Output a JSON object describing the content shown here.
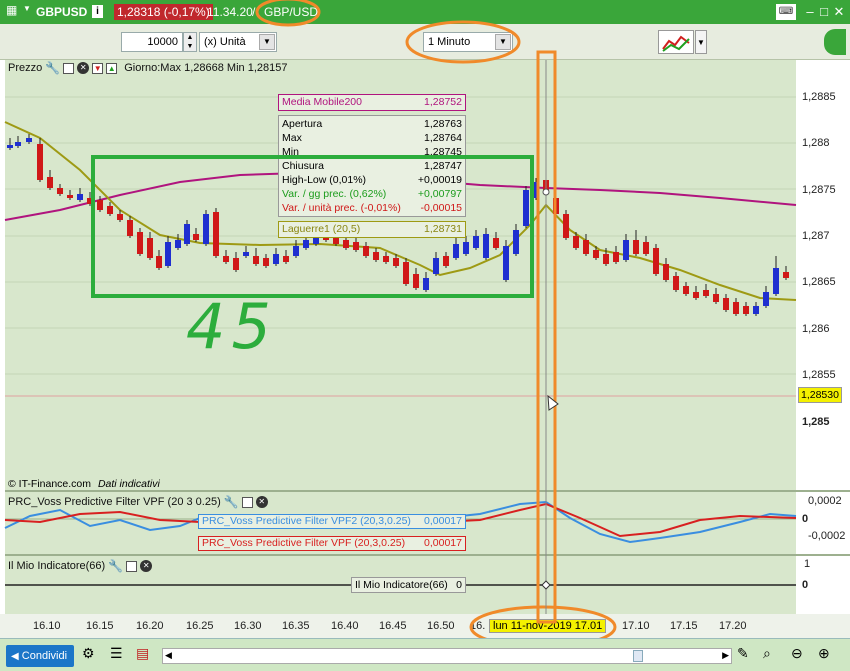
{
  "titlebar": {
    "symbol": "GBPUSD",
    "info_glyph": "i",
    "price_change": "1,28318 (-0,17%)",
    "time": "11.34.20",
    "separator": "/",
    "pair": "GBP/USD"
  },
  "toolbar": {
    "quantity": "10000",
    "unit": "(x) Unità",
    "timeframe": "1 Minuto"
  },
  "price_panel": {
    "title": "Prezzo",
    "day_range": "Giorno:Max 1,28668 Min 1,28157",
    "moving_average_label": "Media Mobile200",
    "moving_average_value": "1,28752",
    "laguerre_label": "Laguerre1 (20,5)",
    "laguerre_value": "1,28731",
    "copyright": "© IT-Finance.com",
    "data_note": "Dati indicativi",
    "current_price_tag": "1,28530",
    "y_ticks": [
      "1,2885",
      "1,288",
      "1,2875",
      "1,287",
      "1,2865",
      "1,286",
      "1,2855",
      "1,285"
    ],
    "ohlc": [
      {
        "label": "Apertura",
        "value": "1,28763"
      },
      {
        "label": "Max",
        "value": "1,28764"
      },
      {
        "label": "Min",
        "value": "1,28745"
      },
      {
        "label": "Chiusura",
        "value": "1,28747"
      },
      {
        "label": "High-Low (0,01%)",
        "value": "+0,00019"
      },
      {
        "label": "Var. / gg prec. (0,62%)",
        "value": "+0,00797"
      },
      {
        "label": "Var. / unità prec. (-0,01%)",
        "value": "-0,00015"
      }
    ]
  },
  "vpf_panel": {
    "title": "PRC_Voss Predictive Filter VPF (20 3 0.25)",
    "vpf2_label": "PRC_Voss Predictive Filter VPF2 (20,3,0.25)",
    "vpf2_value": "0,00017",
    "vpf_label": "PRC_Voss Predictive Filter VPF (20,3,0.25)",
    "vpf_value": "0,00017",
    "y_ticks": [
      "0,0002",
      "0",
      "-0,0002"
    ]
  },
  "mio_panel": {
    "title": "Il Mio Indicatore(66)",
    "tooltip_label": "Il Mio Indicatore(66)",
    "tooltip_value": "0",
    "y_ticks": [
      "1",
      "0"
    ]
  },
  "x_axis": {
    "ticks": [
      "16.10",
      "16.15",
      "16.20",
      "16.25",
      "16.30",
      "16.35",
      "16.40",
      "16.45",
      "16.50",
      "16.",
      "17.10",
      "17.15",
      "17.20"
    ],
    "cursor_date": "lun 11-nov-2019 17.01"
  },
  "annotation": {
    "handwritten": "45"
  },
  "bottombar": {
    "share_label": "Condividi"
  },
  "colors": {
    "title_green": "#3aa63a",
    "chart_bg": "#d8e7cc",
    "bull_candle": "#1f2fd0",
    "bear_candle": "#d01818",
    "ma200": "#b0147e",
    "laguerre": "#9e9a14",
    "vpf": "#d82020",
    "vpf2": "#3a8ee0",
    "orange_annotation": "#f08a2a",
    "green_annotation": "#2cad3c"
  }
}
